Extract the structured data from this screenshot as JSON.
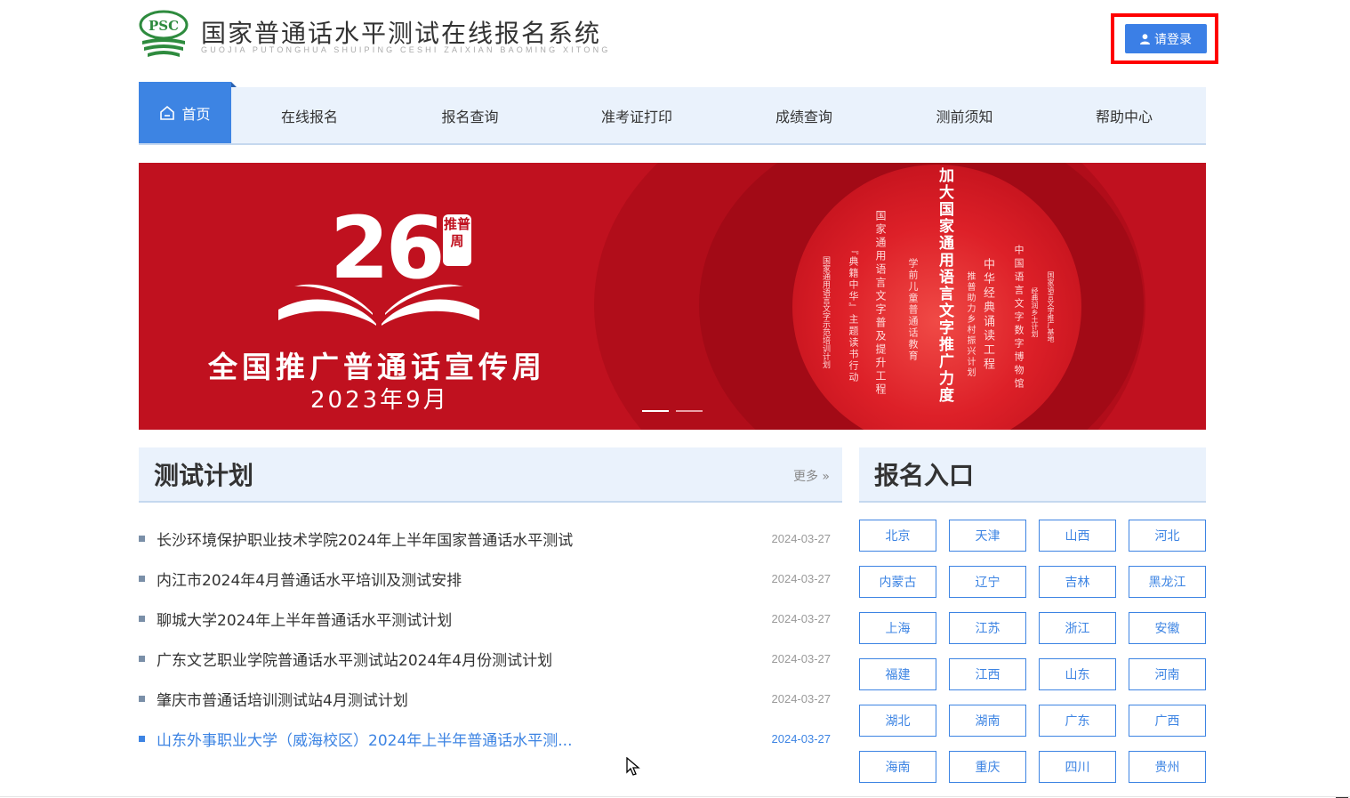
{
  "header": {
    "title": "国家普通话水平测试在线报名系统",
    "subtitle": "GUOJIA PUTONGHUA SHUIPING CESHI ZAIXIAN BAOMING XITONG",
    "logo_text": "PSC",
    "login_label": "请登录"
  },
  "nav": {
    "items": [
      {
        "label": "首页",
        "active": true
      },
      {
        "label": "在线报名"
      },
      {
        "label": "报名查询"
      },
      {
        "label": "准考证打印"
      },
      {
        "label": "成绩查询"
      },
      {
        "label": "测前须知"
      },
      {
        "label": "帮助中心"
      }
    ]
  },
  "banner": {
    "number": "26",
    "seal": "推普周",
    "title": "全国推广普通话宣传周",
    "date": "2023年9月",
    "headline": "加大国家通用语言文字推广力度",
    "columns": [
      "国家通用语言文字示范培训计划",
      "『典籍中华』主题读书行动",
      "国家通用语言文字普及提升工程",
      "学前儿童普通话教育",
      "中华经典诵读工程",
      "推普助力乡村振兴计划",
      "中国语言文字数字博物馆",
      "经典润乡土计划",
      "国家语言文字推广基地"
    ],
    "slide_count": 2,
    "active_slide": 1
  },
  "plan": {
    "title": "测试计划",
    "more_label": "更多",
    "items": [
      {
        "title": "长沙环境保护职业技术学院2024年上半年国家普通话水平测试",
        "date": "2024-03-27"
      },
      {
        "title": "内江市2024年4月普通话水平培训及测试安排",
        "date": "2024-03-27"
      },
      {
        "title": "聊城大学2024年上半年普通话水平测试计划",
        "date": "2024-03-27"
      },
      {
        "title": "广东文艺职业学院普通话水平测试站2024年4月份测试计划",
        "date": "2024-03-27"
      },
      {
        "title": "肇庆市普通话培训测试站4月测试计划",
        "date": "2024-03-27"
      },
      {
        "title": "山东外事职业大学（威海校区）2024年上半年普通话水平测...",
        "date": "2024-03-27",
        "highlighted": true
      }
    ]
  },
  "registration": {
    "title": "报名入口",
    "regions": [
      "北京",
      "天津",
      "山西",
      "河北",
      "内蒙古",
      "辽宁",
      "吉林",
      "黑龙江",
      "上海",
      "江苏",
      "浙江",
      "安徽",
      "福建",
      "江西",
      "山东",
      "河南",
      "湖北",
      "湖南",
      "广东",
      "广西",
      "海南",
      "重庆",
      "四川",
      "贵州"
    ]
  },
  "colors": {
    "accent": "#3d84e3",
    "nav_bg": "#eaf2fc",
    "banner_red": "#c0111f",
    "highlight_frame": "#ff0000"
  }
}
